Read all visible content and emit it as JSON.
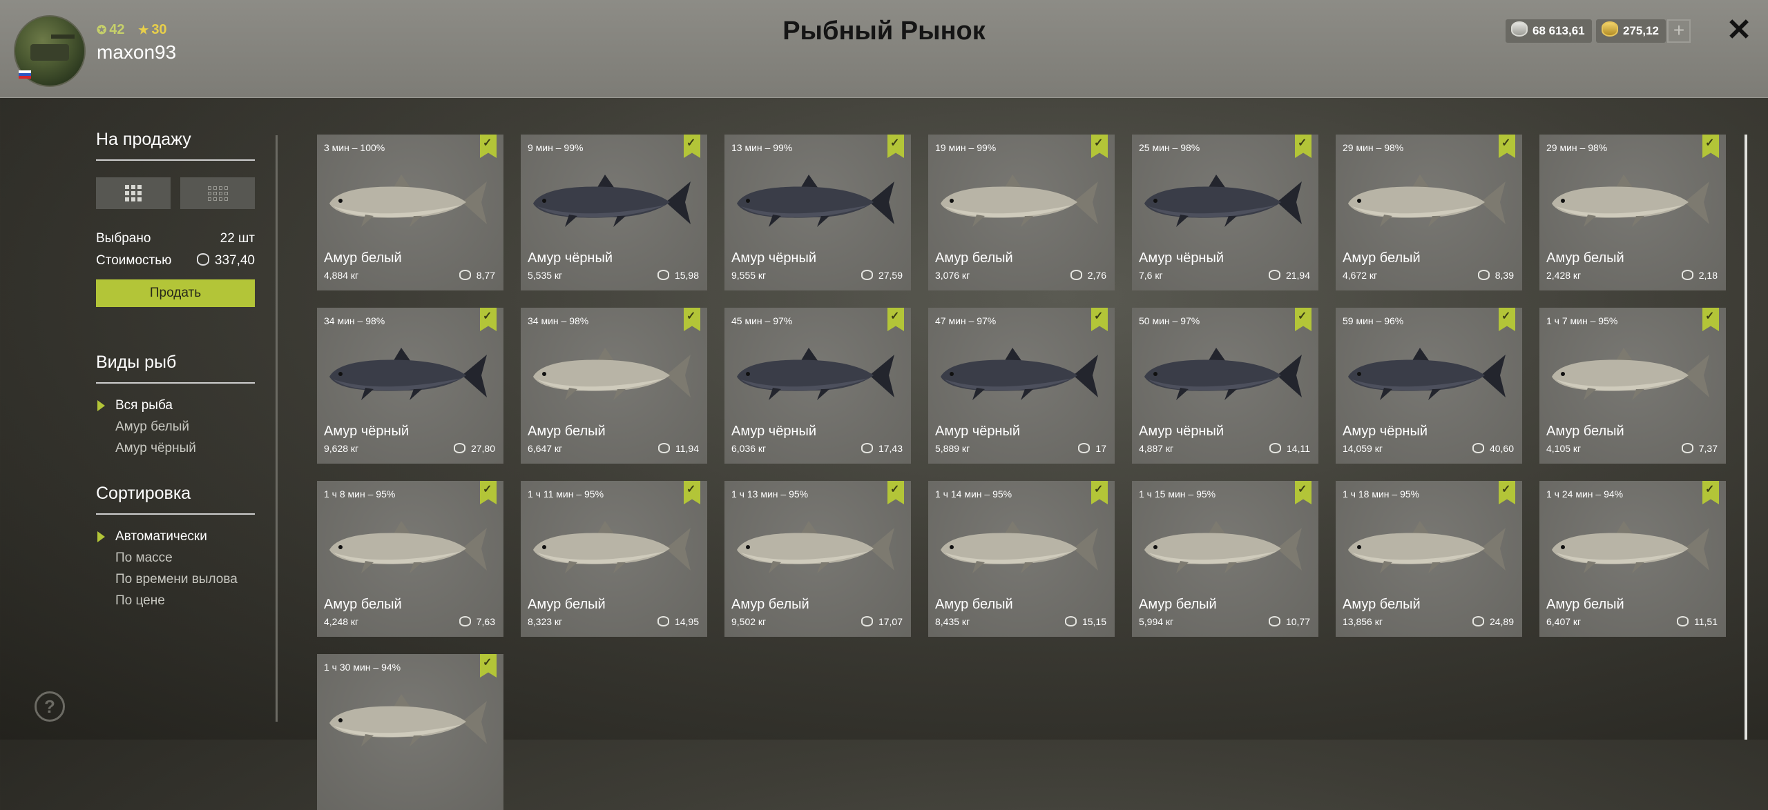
{
  "header": {
    "title": "Рыбный Рынок",
    "level": "42",
    "rank": "30",
    "username": "maxon93",
    "silver": "68 613,61",
    "gold": "275,12",
    "plus_label": "+",
    "close_label": "✕"
  },
  "sidebar": {
    "for_sale_title": "На продажу",
    "selected_label": "Выбрано",
    "selected_value": "22 шт",
    "cost_label": "Стоимостью",
    "cost_value": "337,40",
    "sell_label": "Продать",
    "species_title": "Виды рыб",
    "species": [
      "Вся рыба",
      "Амур белый",
      "Амур чёрный"
    ],
    "sort_title": "Сортировка",
    "sort_options": [
      "Автоматически",
      "По массе",
      "По времени вылова",
      "По цене"
    ],
    "help_label": "?"
  },
  "fish": [
    {
      "time": "3 мин – 100%",
      "name": "Амур белый",
      "weight": "4,884 кг",
      "price": "8,77",
      "kind": "white"
    },
    {
      "time": "9 мин – 99%",
      "name": "Амур чёрный",
      "weight": "5,535 кг",
      "price": "15,98",
      "kind": "black"
    },
    {
      "time": "13 мин – 99%",
      "name": "Амур чёрный",
      "weight": "9,555 кг",
      "price": "27,59",
      "kind": "black"
    },
    {
      "time": "19 мин – 99%",
      "name": "Амур белый",
      "weight": "3,076 кг",
      "price": "2,76",
      "kind": "white"
    },
    {
      "time": "25 мин – 98%",
      "name": "Амур чёрный",
      "weight": "7,6 кг",
      "price": "21,94",
      "kind": "black"
    },
    {
      "time": "29 мин – 98%",
      "name": "Амур белый",
      "weight": "4,672 кг",
      "price": "8,39",
      "kind": "white"
    },
    {
      "time": "29 мин – 98%",
      "name": "Амур белый",
      "weight": "2,428 кг",
      "price": "2,18",
      "kind": "white"
    },
    {
      "time": "34 мин – 98%",
      "name": "Амур чёрный",
      "weight": "9,628 кг",
      "price": "27,80",
      "kind": "black"
    },
    {
      "time": "34 мин – 98%",
      "name": "Амур белый",
      "weight": "6,647 кг",
      "price": "11,94",
      "kind": "white"
    },
    {
      "time": "45 мин – 97%",
      "name": "Амур чёрный",
      "weight": "6,036 кг",
      "price": "17,43",
      "kind": "black"
    },
    {
      "time": "47 мин – 97%",
      "name": "Амур чёрный",
      "weight": "5,889 кг",
      "price": "17",
      "kind": "black"
    },
    {
      "time": "50 мин – 97%",
      "name": "Амур чёрный",
      "weight": "4,887 кг",
      "price": "14,11",
      "kind": "black"
    },
    {
      "time": "59 мин – 96%",
      "name": "Амур чёрный",
      "weight": "14,059 кг",
      "price": "40,60",
      "kind": "black"
    },
    {
      "time": "1 ч 7 мин – 95%",
      "name": "Амур белый",
      "weight": "4,105 кг",
      "price": "7,37",
      "kind": "white"
    },
    {
      "time": "1 ч 8 мин – 95%",
      "name": "Амур белый",
      "weight": "4,248 кг",
      "price": "7,63",
      "kind": "white"
    },
    {
      "time": "1 ч 11 мин – 95%",
      "name": "Амур белый",
      "weight": "8,323 кг",
      "price": "14,95",
      "kind": "white"
    },
    {
      "time": "1 ч 13 мин – 95%",
      "name": "Амур белый",
      "weight": "9,502 кг",
      "price": "17,07",
      "kind": "white"
    },
    {
      "time": "1 ч 14 мин – 95%",
      "name": "Амур белый",
      "weight": "8,435 кг",
      "price": "15,15",
      "kind": "white"
    },
    {
      "time": "1 ч 15 мин – 95%",
      "name": "Амур белый",
      "weight": "5,994 кг",
      "price": "10,77",
      "kind": "white"
    },
    {
      "time": "1 ч 18 мин – 95%",
      "name": "Амур белый",
      "weight": "13,856 кг",
      "price": "24,89",
      "kind": "white"
    },
    {
      "time": "1 ч 24 мин – 94%",
      "name": "Амур белый",
      "weight": "6,407 кг",
      "price": "11,51",
      "kind": "white"
    },
    {
      "time": "1 ч 30 мин – 94%",
      "name": "",
      "weight": "",
      "price": "",
      "kind": "white"
    }
  ],
  "colors": {
    "accent": "#b3c538",
    "white_fish": "#b8b4a6",
    "black_fish": "#3a3d48"
  }
}
